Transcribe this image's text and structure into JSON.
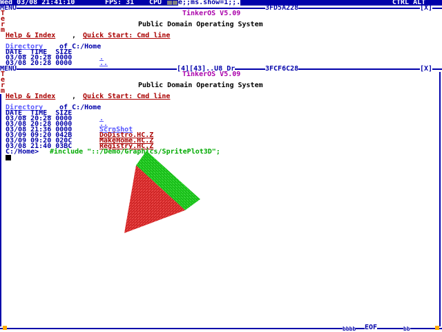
{
  "statusbar": {
    "datetime": "Wed 03/08 21:41:10",
    "fps": "FPS: 31",
    "cpu_label": "CPU",
    "message": "e;;ms.show=1;;.",
    "right": "CTRL ALT"
  },
  "win1": {
    "menu": "MENU",
    "title_task": "TinkerOS V5.09",
    "title_addr": "3FD5A228",
    "close": "[X]",
    "vert_label": [
      "T",
      "e",
      "r",
      "m"
    ],
    "banner": "Public Domain Operating System",
    "help": "Help & Index",
    "quick": "Quick Start: Cmd line",
    "dir_link": "Directory",
    "dir_rest": " of C:/Home",
    "header": "DATE_ TIME_ SIZE",
    "rows": [
      {
        "text": "03/08 20:28 0000",
        "name": "."
      },
      {
        "text": "03/08 20:28 0000",
        "name": ".."
      }
    ]
  },
  "win2": {
    "menu": "MENU",
    "title_pos": "[4][43]..U8_Dr",
    "title_task": "TinkerOS V5.09",
    "title_addr": "3FCF6C28",
    "close": "[X]",
    "vert_label": [
      "T",
      "e",
      "r",
      "m"
    ],
    "banner": "Public Domain Operating System",
    "help": "Help & Index",
    "quick": "Quick Start: Cmd line",
    "dir_link": "Directory",
    "dir_rest": " of C:/Home",
    "header": "DATE_ TIME_ SIZE",
    "rows": [
      {
        "text": "03/08 20:28 0000",
        "name": ".",
        "kind": "dir"
      },
      {
        "text": "03/08 20:28 0000",
        "name": "..",
        "kind": "dir"
      },
      {
        "text": "03/08 21:36 0000",
        "name": "ScrnShot",
        "kind": "dir"
      },
      {
        "text": "03/09 09:20 042B",
        "name": "DoDistro.HC.Z",
        "kind": "file"
      },
      {
        "text": "03/09 09:20 020C",
        "name": "MakeHome.HC.Z",
        "kind": "file"
      },
      {
        "text": "03/08 21:40 03BC",
        "name": "Registry.HC.Z",
        "kind": "file"
      }
    ],
    "prompt": "C:/Home>",
    "command": "#include \"::/Demo/Graphics/SpritePlot3D\";"
  },
  "footer": {
    "left_marks": "bbbb",
    "eof": "EOF",
    "right_marks": "bb"
  },
  "colors": {
    "frame": "#0000aa",
    "link_red": "#aa0000",
    "green_face": "#22cc22",
    "red_face": "#dd3333"
  }
}
